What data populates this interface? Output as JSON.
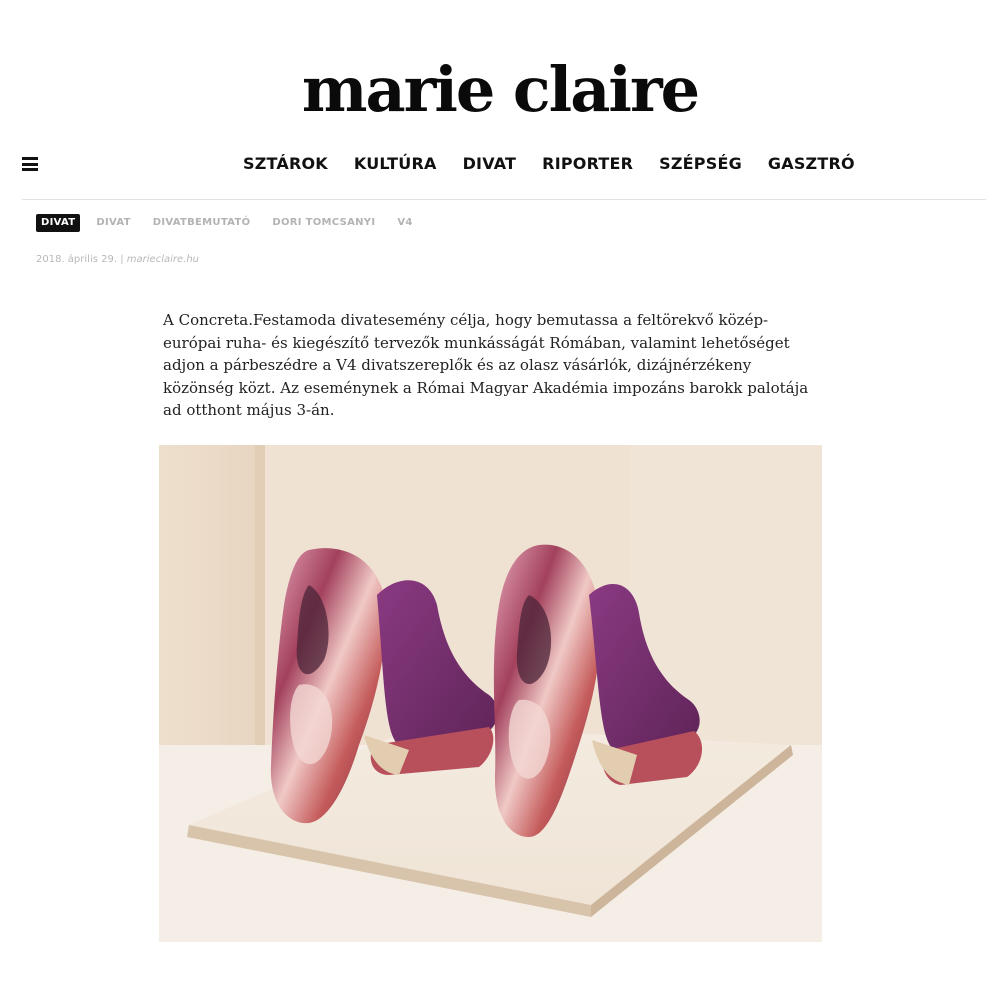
{
  "site": {
    "logo": "marie claire"
  },
  "nav": {
    "menu_icon": "hamburger-icon",
    "items": [
      {
        "label": "SZTÁROK"
      },
      {
        "label": "KULTÚRA"
      },
      {
        "label": "DIVAT"
      },
      {
        "label": "RIPORTER"
      },
      {
        "label": "SZÉPSÉG"
      },
      {
        "label": "GASZTRÓ"
      }
    ]
  },
  "article": {
    "tags": [
      {
        "label": "DIVAT",
        "active": true
      },
      {
        "label": "DIVAT"
      },
      {
        "label": "DIVATBEMUTATÓ"
      },
      {
        "label": "DORI TOMCSANYI"
      },
      {
        "label": "V4"
      }
    ],
    "date": "2018. április 29.",
    "separator": "|",
    "source": "marieclaire.hu",
    "lead": "A Concreta.Festamoda divatesemény célja, hogy bemutassa a feltörekvő közép-európai ruha- és kiegészítő tervezők munkásságát Rómában, valamint lehetőséget adjon a párbeszédre a V4 divatszereplők és az olasz vásárlók, dizájnérzékeny közönség közt. Az eseménynek a Római Magyar Akadémia impozáns barokk palotája ad otthont május 3-án."
  },
  "colors": {
    "text": "#111111",
    "muted": "#b3b3b3",
    "tag_active_bg": "#111111",
    "shoe_purple": "#6d2a66",
    "backdrop": "#ecdccb"
  }
}
